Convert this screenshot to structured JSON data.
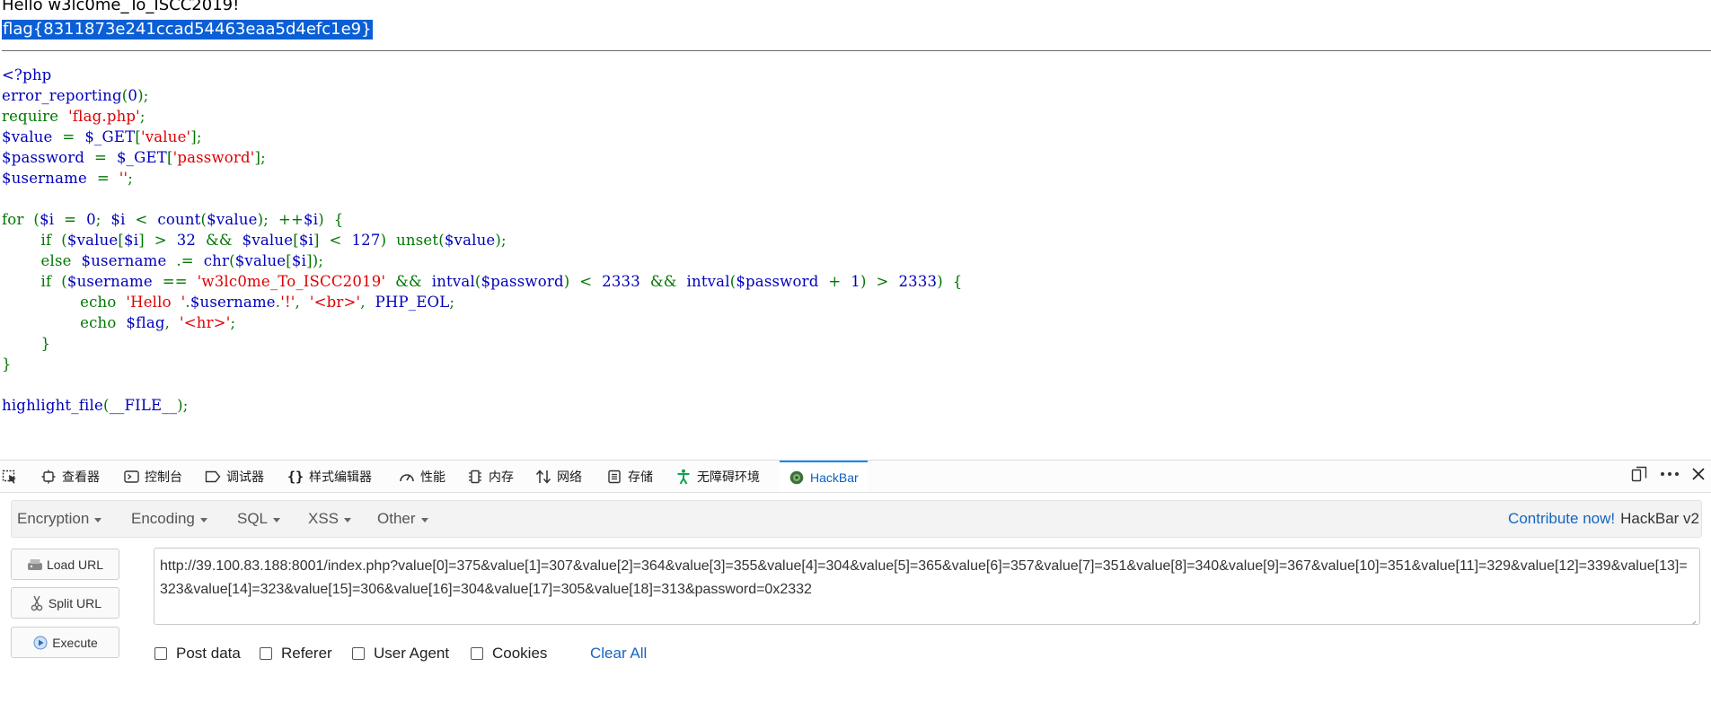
{
  "page": {
    "hello_line": "Hello w3lc0me_To_ISCC2019!",
    "flag_line": "flag{8311873e241ccad54463eaa5d4efc1e9}",
    "code_lines": [
      [
        {
          "t": "<?php",
          "c": "df"
        }
      ],
      [
        {
          "t": "error_reporting",
          "c": "df"
        },
        {
          "t": "(",
          "c": "kw"
        },
        {
          "t": "0",
          "c": "df"
        },
        {
          "t": ");",
          "c": "kw"
        }
      ],
      [
        {
          "t": "require  ",
          "c": "kw"
        },
        {
          "t": "'flag.php'",
          "c": "st"
        },
        {
          "t": ";",
          "c": "kw"
        }
      ],
      [
        {
          "t": "$value  ",
          "c": "df"
        },
        {
          "t": "=  ",
          "c": "kw"
        },
        {
          "t": "$_GET",
          "c": "df"
        },
        {
          "t": "[",
          "c": "kw"
        },
        {
          "t": "'value'",
          "c": "st"
        },
        {
          "t": "];",
          "c": "kw"
        }
      ],
      [
        {
          "t": "$password  ",
          "c": "df"
        },
        {
          "t": "=  ",
          "c": "kw"
        },
        {
          "t": "$_GET",
          "c": "df"
        },
        {
          "t": "[",
          "c": "kw"
        },
        {
          "t": "'password'",
          "c": "st"
        },
        {
          "t": "];",
          "c": "kw"
        }
      ],
      [
        {
          "t": "$username  ",
          "c": "df"
        },
        {
          "t": "=  ",
          "c": "kw"
        },
        {
          "t": "''",
          "c": "st"
        },
        {
          "t": ";",
          "c": "kw"
        }
      ],
      [
        {
          "t": "",
          "c": "df"
        }
      ],
      [
        {
          "t": "for  (",
          "c": "kw"
        },
        {
          "t": "$i  ",
          "c": "df"
        },
        {
          "t": "=  ",
          "c": "kw"
        },
        {
          "t": "0",
          "c": "df"
        },
        {
          "t": ";  ",
          "c": "kw"
        },
        {
          "t": "$i  ",
          "c": "df"
        },
        {
          "t": "<  ",
          "c": "kw"
        },
        {
          "t": "count",
          "c": "df"
        },
        {
          "t": "(",
          "c": "kw"
        },
        {
          "t": "$value",
          "c": "df"
        },
        {
          "t": ");  ++",
          "c": "kw"
        },
        {
          "t": "$i",
          "c": "df"
        },
        {
          "t": ")  {",
          "c": "kw"
        }
      ],
      [
        {
          "t": "        if  (",
          "c": "kw"
        },
        {
          "t": "$value",
          "c": "df"
        },
        {
          "t": "[",
          "c": "kw"
        },
        {
          "t": "$i",
          "c": "df"
        },
        {
          "t": "]  >  ",
          "c": "kw"
        },
        {
          "t": "32  ",
          "c": "df"
        },
        {
          "t": "&&  ",
          "c": "kw"
        },
        {
          "t": "$value",
          "c": "df"
        },
        {
          "t": "[",
          "c": "kw"
        },
        {
          "t": "$i",
          "c": "df"
        },
        {
          "t": "]  <  ",
          "c": "kw"
        },
        {
          "t": "127",
          "c": "df"
        },
        {
          "t": ")  ",
          "c": "kw"
        },
        {
          "t": "unset",
          "c": "kw"
        },
        {
          "t": "(",
          "c": "kw"
        },
        {
          "t": "$value",
          "c": "df"
        },
        {
          "t": ");",
          "c": "kw"
        }
      ],
      [
        {
          "t": "        else  ",
          "c": "kw"
        },
        {
          "t": "$username  ",
          "c": "df"
        },
        {
          "t": ".=  ",
          "c": "kw"
        },
        {
          "t": "chr",
          "c": "df"
        },
        {
          "t": "(",
          "c": "kw"
        },
        {
          "t": "$value",
          "c": "df"
        },
        {
          "t": "[",
          "c": "kw"
        },
        {
          "t": "$i",
          "c": "df"
        },
        {
          "t": "]);",
          "c": "kw"
        }
      ],
      [
        {
          "t": "        if  (",
          "c": "kw"
        },
        {
          "t": "$username  ",
          "c": "df"
        },
        {
          "t": "==  ",
          "c": "kw"
        },
        {
          "t": "'w3lc0me_To_ISCC2019'  ",
          "c": "st"
        },
        {
          "t": "&&  ",
          "c": "kw"
        },
        {
          "t": "intval",
          "c": "df"
        },
        {
          "t": "(",
          "c": "kw"
        },
        {
          "t": "$password",
          "c": "df"
        },
        {
          "t": ")  <  ",
          "c": "kw"
        },
        {
          "t": "2333  ",
          "c": "df"
        },
        {
          "t": "&&  ",
          "c": "kw"
        },
        {
          "t": "intval",
          "c": "df"
        },
        {
          "t": "(",
          "c": "kw"
        },
        {
          "t": "$password  ",
          "c": "df"
        },
        {
          "t": "+  ",
          "c": "kw"
        },
        {
          "t": "1",
          "c": "df"
        },
        {
          "t": ")  >  ",
          "c": "kw"
        },
        {
          "t": "2333",
          "c": "df"
        },
        {
          "t": ")  {",
          "c": "kw"
        }
      ],
      [
        {
          "t": "                echo  ",
          "c": "kw"
        },
        {
          "t": "'Hello  '",
          "c": "st"
        },
        {
          "t": ".",
          "c": "kw"
        },
        {
          "t": "$username",
          "c": "df"
        },
        {
          "t": ".",
          "c": "kw"
        },
        {
          "t": "'!'",
          "c": "st"
        },
        {
          "t": ",  ",
          "c": "kw"
        },
        {
          "t": "'<br>'",
          "c": "st"
        },
        {
          "t": ",  ",
          "c": "kw"
        },
        {
          "t": "PHP_EOL",
          "c": "df"
        },
        {
          "t": ";",
          "c": "kw"
        }
      ],
      [
        {
          "t": "                echo  ",
          "c": "kw"
        },
        {
          "t": "$flag",
          "c": "df"
        },
        {
          "t": ",  ",
          "c": "kw"
        },
        {
          "t": "'<hr>'",
          "c": "st"
        },
        {
          "t": ";",
          "c": "kw"
        }
      ],
      [
        {
          "t": "        }",
          "c": "kw"
        }
      ],
      [
        {
          "t": "}",
          "c": "kw"
        }
      ],
      [
        {
          "t": "",
          "c": "df"
        }
      ],
      [
        {
          "t": "highlight_file",
          "c": "df"
        },
        {
          "t": "(",
          "c": "kw"
        },
        {
          "t": "__FILE__",
          "c": "df"
        },
        {
          "t": ");",
          "c": "kw"
        }
      ]
    ]
  },
  "devtools": {
    "tabs": [
      {
        "label": "查看器",
        "icon": "inspector-icon"
      },
      {
        "label": "控制台",
        "icon": "console-icon"
      },
      {
        "label": "调试器",
        "icon": "debugger-icon"
      },
      {
        "label": "样式编辑器",
        "icon": "style-editor-icon"
      },
      {
        "label": "性能",
        "icon": "performance-icon"
      },
      {
        "label": "内存",
        "icon": "memory-icon"
      },
      {
        "label": "网络",
        "icon": "network-icon"
      },
      {
        "label": "存储",
        "icon": "storage-icon"
      },
      {
        "label": "无障碍环境",
        "icon": "accessibility-icon"
      },
      {
        "label": "HackBar",
        "icon": "hackbar-icon"
      }
    ],
    "active_tab": "HackBar"
  },
  "hackbar": {
    "menus": [
      "Encryption",
      "Encoding",
      "SQL",
      "XSS",
      "Other"
    ],
    "contribute": "Contribute now!",
    "version": "HackBar v2",
    "buttons": {
      "load": "Load URL",
      "split": "Split URL",
      "execute": "Execute"
    },
    "url": "http://39.100.83.188:8001/index.php?value[0]=375&value[1]=307&value[2]=364&value[3]=355&value[4]=304&value[5]=365&value[6]=357&value[7]=351&value[8]=340&value[9]=367&value[10]=351&value[11]=329&value[12]=339&value[13]=323&value[14]=323&value[15]=306&value[16]=304&value[17]=305&value[18]=313&password=0x2332",
    "options": [
      {
        "label": "Post data",
        "checked": false
      },
      {
        "label": "Referer",
        "checked": false
      },
      {
        "label": "User Agent",
        "checked": false
      },
      {
        "label": "Cookies",
        "checked": false
      }
    ],
    "clear_all": "Clear All"
  },
  "colors": {
    "accent": "#0a84ff",
    "link": "#1565c0",
    "selection": "#0b5fd6",
    "php_keyword": "#007700",
    "php_string": "#dd0000",
    "php_default": "#0000bb"
  }
}
